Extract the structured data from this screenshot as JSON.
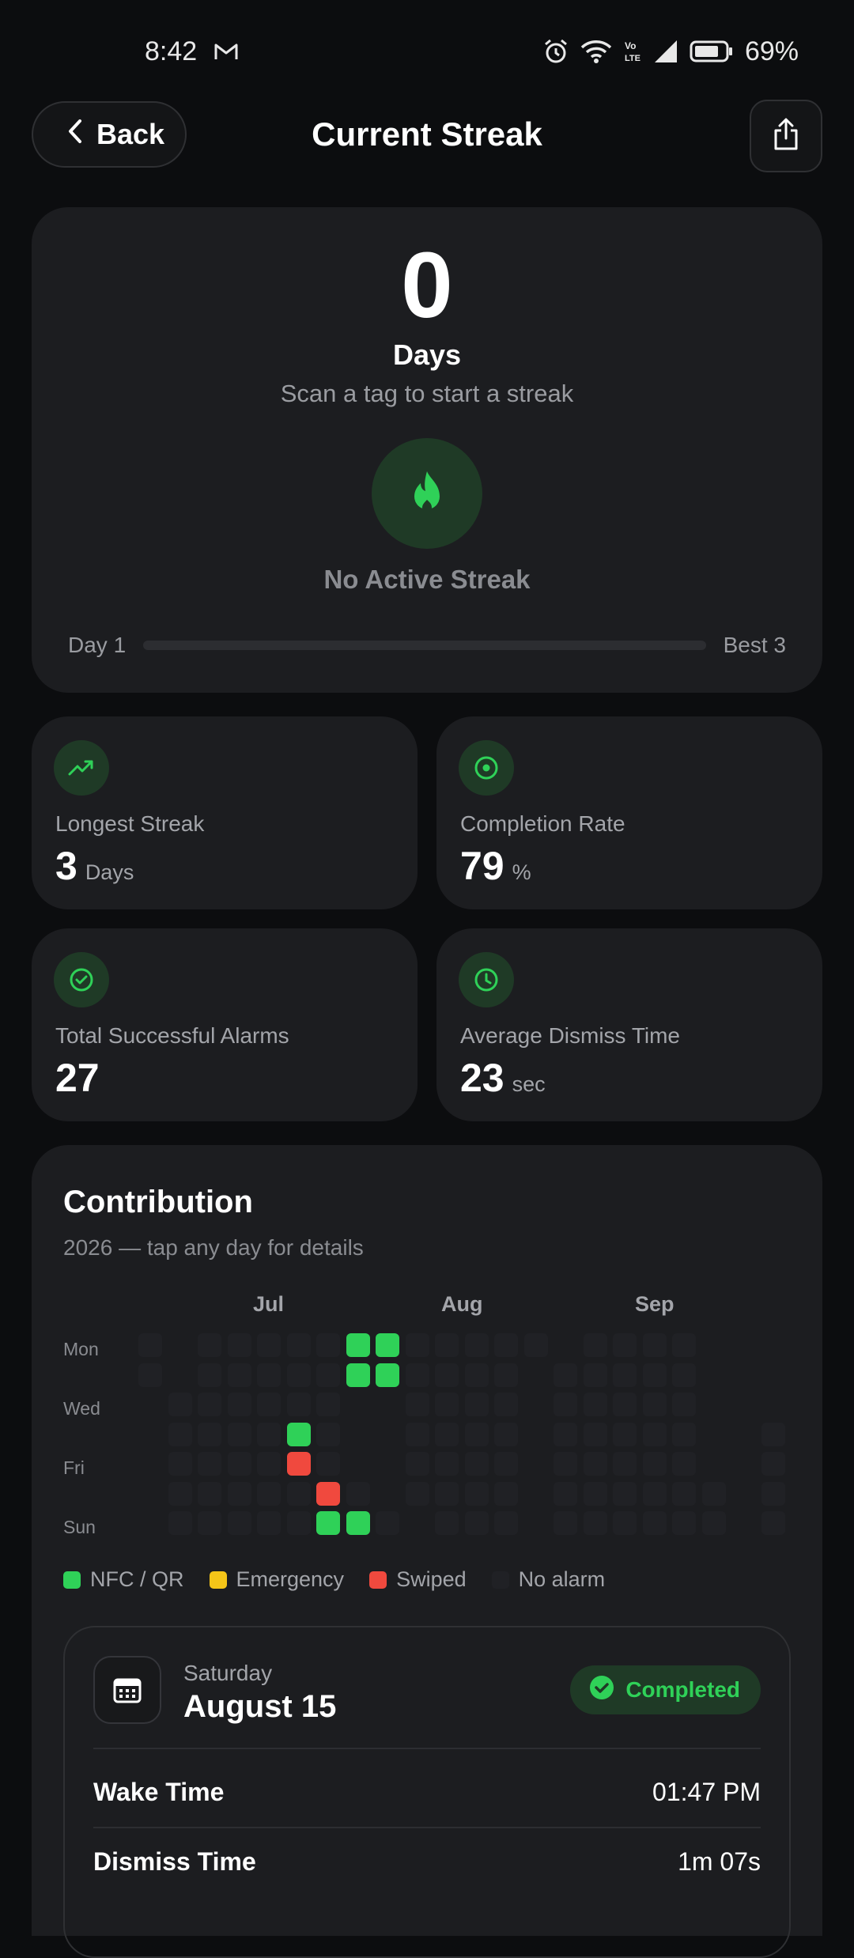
{
  "status_bar": {
    "time": "8:42",
    "battery": "69%",
    "icons": [
      "gmail-icon",
      "alarm-icon",
      "wifi-icon",
      "volte-icon",
      "signal-icon",
      "battery-icon"
    ]
  },
  "header": {
    "back_label": "Back",
    "title": "Current Streak"
  },
  "hero": {
    "count": "0",
    "unit": "Days",
    "subtitle": "Scan a tag to start a streak",
    "status": "No Active Streak",
    "progress_start": "Day 1",
    "progress_end": "Best 3",
    "progress_fraction": 0
  },
  "stats": [
    {
      "label": "Longest Streak",
      "value": "3",
      "unit": "Days",
      "icon": "trend-up-icon"
    },
    {
      "label": "Completion Rate",
      "value": "79",
      "unit": "%",
      "icon": "target-icon"
    },
    {
      "label": "Total Successful Alarms",
      "value": "27",
      "unit": "",
      "icon": "check-circle-icon"
    },
    {
      "label": "Average Dismiss Time",
      "value": "23",
      "unit": "sec",
      "icon": "clock-icon"
    }
  ],
  "contribution": {
    "title": "Contribution",
    "subtitle": "2026 — tap any day for details",
    "months": [
      "Jul",
      "Aug",
      "Sep"
    ],
    "day_labels": [
      "Mon",
      "Wed",
      "Fri",
      "Sun"
    ],
    "legend": [
      {
        "label": "NFC / QR",
        "color": "#2fd158"
      },
      {
        "label": "Emergency",
        "color": "#f5c518"
      },
      {
        "label": "Swiped",
        "color": "#f0493e"
      },
      {
        "label": "No alarm",
        "color": "#202125"
      }
    ]
  },
  "selected_day": {
    "weekday": "Saturday",
    "date": "August 15",
    "status": "Completed",
    "rows": [
      {
        "label": "Wake Time",
        "value": "01:47 PM"
      },
      {
        "label": "Dismiss Time",
        "value": "1m 07s"
      }
    ]
  }
}
